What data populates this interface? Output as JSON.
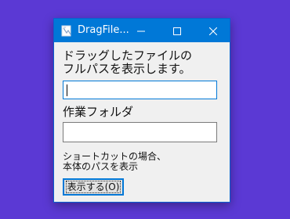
{
  "window": {
    "title": "DragFile...",
    "icon": "app-file-icon"
  },
  "titlebar_buttons": {
    "minimize": "minimize-icon",
    "maximize": "maximize-icon",
    "close": "close-icon"
  },
  "main": {
    "instruction_line1": "ドラッグしたファイルの",
    "instruction_line2": "フルパスを表示します。",
    "path_value": "",
    "work_folder_label": "作業フォルダ",
    "work_folder_value": "",
    "shortcut_note_line1": "ショートカットの場合、",
    "shortcut_note_line2": "本体のパスを表示",
    "show_button_label": "表示する(O)"
  },
  "colors": {
    "desktop": "#5b39d4",
    "titlebar": "#0078d7",
    "window_bg": "#f0f0f0",
    "focus_border": "#0078d7"
  }
}
